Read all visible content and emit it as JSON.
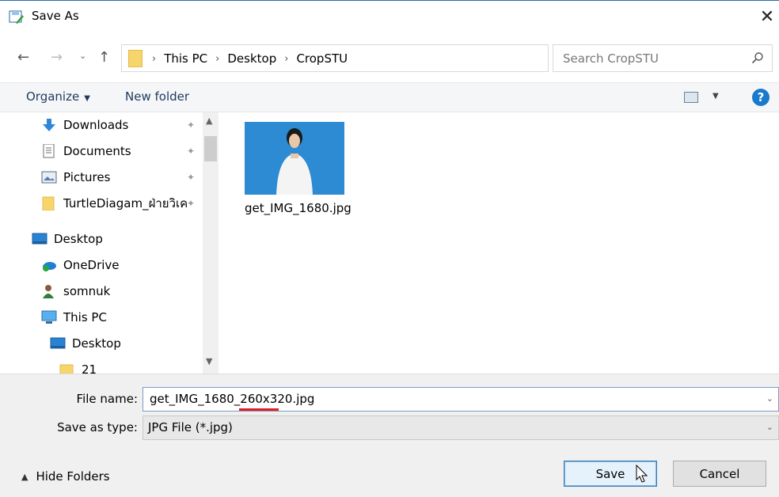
{
  "window": {
    "title": "Save As",
    "close_glyph": "✕"
  },
  "nav": {
    "back": "←",
    "forward": "→",
    "recent": "⌄",
    "up": "↑"
  },
  "address": {
    "crumbs": [
      "This PC",
      "Desktop",
      "CropSTU"
    ],
    "separator": "›",
    "dropdown": "⌄",
    "refresh": "↻"
  },
  "search": {
    "placeholder": "Search CropSTU"
  },
  "toolbar": {
    "organize": "Organize",
    "new_folder": "New folder",
    "help": "?"
  },
  "navpane": {
    "items": [
      {
        "label": "Downloads",
        "icon": "download-arrow-icon",
        "pinned": true
      },
      {
        "label": "Documents",
        "icon": "documents-icon",
        "pinned": true
      },
      {
        "label": "Pictures",
        "icon": "pictures-icon",
        "pinned": true
      },
      {
        "label": "TurtleDiagam_ฝ่ายวิเค",
        "icon": "folder-icon",
        "pinned": true
      },
      {
        "label": "Desktop",
        "icon": "desktop-icon",
        "pinned": false
      },
      {
        "label": "OneDrive",
        "icon": "onedrive-icon",
        "pinned": false
      },
      {
        "label": "somnuk",
        "icon": "user-icon",
        "pinned": false
      },
      {
        "label": "This PC",
        "icon": "pc-icon",
        "pinned": false
      },
      {
        "label": "Desktop",
        "icon": "desktop-icon",
        "pinned": false
      },
      {
        "label": "21",
        "icon": "folder-icon",
        "pinned": false
      }
    ],
    "pin_glyph": "✦"
  },
  "files": [
    {
      "name": "get_IMG_1680.jpg",
      "icon": "photo-thumbnail"
    }
  ],
  "form": {
    "filename_label": "File name:",
    "filename_value": "get_IMG_1680_260x320.jpg",
    "type_label": "Save as type:",
    "type_value": "JPG File (*.jpg)",
    "caret": "⌄"
  },
  "footer": {
    "hide_folders": "Hide Folders",
    "save": "Save",
    "cancel": "Cancel"
  },
  "colors": {
    "accent": "#1979ca",
    "highlight_underline": "#e02020",
    "thumb_bg": "#2d8bd3"
  }
}
